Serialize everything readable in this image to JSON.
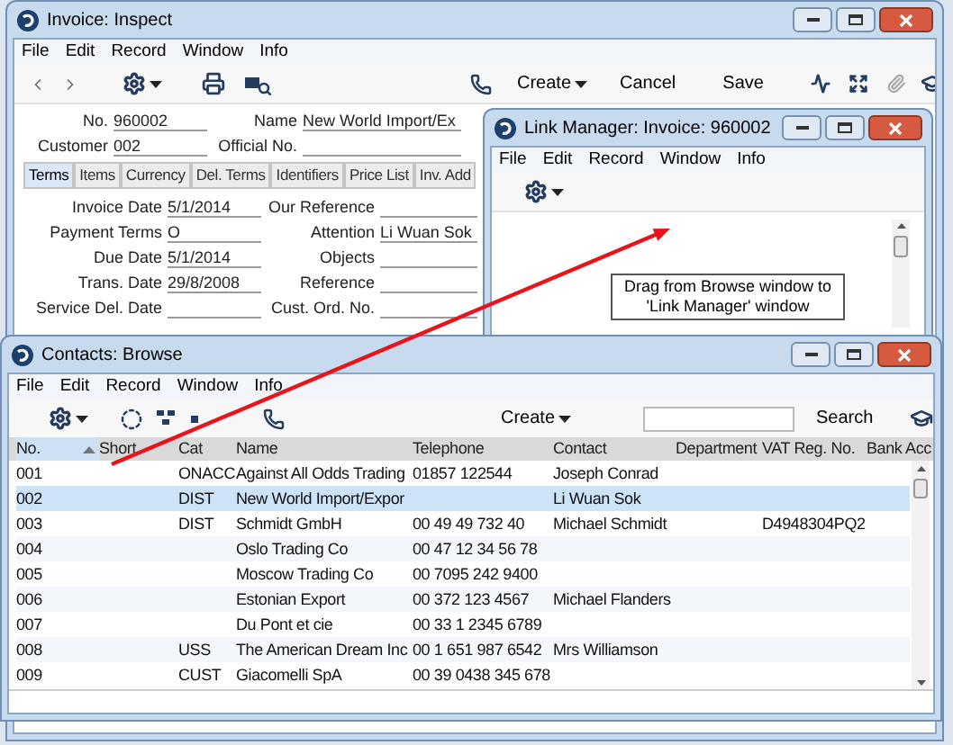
{
  "invoice_window": {
    "title": "Invoice: Inspect",
    "menu": [
      "File",
      "Edit",
      "Record",
      "Window",
      "Info"
    ],
    "toolbar": {
      "create": "Create",
      "cancel": "Cancel",
      "save": "Save"
    },
    "header_left": [
      {
        "label": "No.",
        "value": "960002"
      },
      {
        "label": "Customer",
        "value": "002"
      }
    ],
    "header_right": [
      {
        "label": "Name",
        "value": "New World Import/Ex"
      },
      {
        "label": "Official No."
      }
    ],
    "tabs": [
      {
        "label": "Terms",
        "selected": true
      },
      {
        "label": "Items",
        "selected": false
      },
      {
        "label": "Currency",
        "selected": false
      },
      {
        "label": "Del. Terms",
        "selected": false
      },
      {
        "label": "Identifiers",
        "selected": false
      },
      {
        "label": "Price List",
        "selected": false
      },
      {
        "label": "Inv. Add",
        "selected": false
      }
    ],
    "fields_left": [
      {
        "label": "Invoice Date",
        "value": "5/1/2014"
      },
      {
        "label": "Payment Terms",
        "value": "O"
      },
      {
        "label": "Due Date",
        "value": "5/1/2014"
      },
      {
        "label": "Trans. Date",
        "value": "29/8/2008"
      },
      {
        "label": "Service Del. Date"
      }
    ],
    "fields_right": [
      {
        "label": "Our Reference"
      },
      {
        "label": "Attention",
        "value": "Li Wuan Sok"
      },
      {
        "label": "Objects"
      },
      {
        "label": "Reference"
      },
      {
        "label": "Cust. Ord. No."
      }
    ]
  },
  "link_manager_window": {
    "title": "Link Manager: Invoice: 960002",
    "menu": [
      "File",
      "Edit",
      "Record",
      "Window",
      "Info"
    ],
    "note": "Drag from Browse window to 'Link Manager' window"
  },
  "contacts_window": {
    "title": "Contacts: Browse",
    "menu": [
      "File",
      "Edit",
      "Record",
      "Window",
      "Info"
    ],
    "toolbar": {
      "create": "Create",
      "search": "Search"
    },
    "table": {
      "columns": [
        {
          "label": "No.",
          "sorted": true
        },
        {
          "label": "Short",
          "sorted": false
        },
        {
          "label": "Cat",
          "sorted": false
        },
        {
          "label": "Name",
          "sorted": false
        },
        {
          "label": "Telephone",
          "sorted": false
        },
        {
          "label": "Contact",
          "sorted": false
        },
        {
          "label": "Department",
          "sorted": false
        },
        {
          "label": "VAT Reg. No.",
          "sorted": false
        },
        {
          "label": "Bank Acc",
          "sorted": false
        }
      ],
      "rows": [
        {
          "no": "001",
          "cat": "ONACC",
          "name": "Against All Odds Trading",
          "telephone": "01857 122544",
          "contact": "Joseph Conrad",
          "selected": false
        },
        {
          "no": "002",
          "cat": "DIST",
          "name": "New World Import/Expor",
          "contact": "Li Wuan Sok",
          "selected": true
        },
        {
          "no": "003",
          "cat": "DIST",
          "name": "Schmidt GmbH",
          "telephone": "00 49 49 732 40",
          "contact": "Michael Schmidt",
          "vat_reg_no": "D4948304PQ2",
          "selected": false
        },
        {
          "no": "004",
          "name": "Oslo Trading Co",
          "telephone": "00 47 12 34 56 78",
          "selected": false
        },
        {
          "no": "005",
          "name": "Moscow Trading Co",
          "telephone": "00 7095 242 9400",
          "selected": false
        },
        {
          "no": "006",
          "name": "Estonian Export",
          "telephone": "00 372 123 4567",
          "contact": "Michael Flanders",
          "selected": false
        },
        {
          "no": "007",
          "name": "Du Pont et cie",
          "telephone": "00 33 1 2345 6789",
          "selected": false
        },
        {
          "no": "008",
          "cat": "USS",
          "name": "The American Dream Inc",
          "telephone": "00 1 651 987 6542",
          "contact": "Mrs Williamson",
          "selected": false
        },
        {
          "no": "009",
          "cat": "CUST",
          "name": "Giacomelli SpA",
          "telephone": "00 39 0438 345 678",
          "selected": false
        }
      ]
    }
  }
}
